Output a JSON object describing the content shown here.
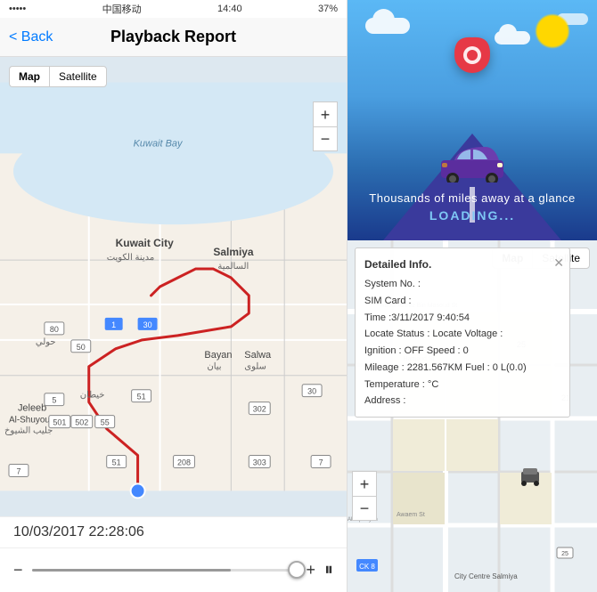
{
  "left": {
    "statusBar": {
      "signal": "•••••",
      "carrier": "中国移动",
      "time": "14:40",
      "battery": "37%"
    },
    "navBar": {
      "backLabel": "< Back",
      "title": "Playback Report"
    },
    "mapTypes": {
      "map": "Map",
      "satellite": "Satellite"
    },
    "mapControls": {
      "zoomIn": "+",
      "zoomOut": "−"
    },
    "timestamp": "10/03/2017 22:28:06",
    "playbackControls": {
      "minus": "−",
      "plus": "+",
      "pause": "⏸"
    }
  },
  "right": {
    "illustration": {
      "tagline": "Thousands of miles away at a glance",
      "loading": "LOADING..."
    },
    "bottomMap": {
      "mapTypes": {
        "map": "Map",
        "satellite": "Satellite"
      },
      "infoPanel": {
        "title": "Detailed Info.",
        "fields": [
          {
            "label": "System No. :",
            "value": ""
          },
          {
            "label": "SIM Card :",
            "value": ""
          },
          {
            "label": "Time :",
            "value": "3/11/2017 9:40:54"
          },
          {
            "label": "Locate Status :",
            "value": "Locate Voltage :"
          },
          {
            "label": "Ignition :",
            "value": "OFF Speed : 0"
          },
          {
            "label": "Mileage :",
            "value": "2281.567KM Fuel : 0 L(0.0)"
          },
          {
            "label": "Temperature :",
            "value": "°C"
          },
          {
            "label": "Address :",
            "value": ""
          }
        ]
      }
    }
  }
}
